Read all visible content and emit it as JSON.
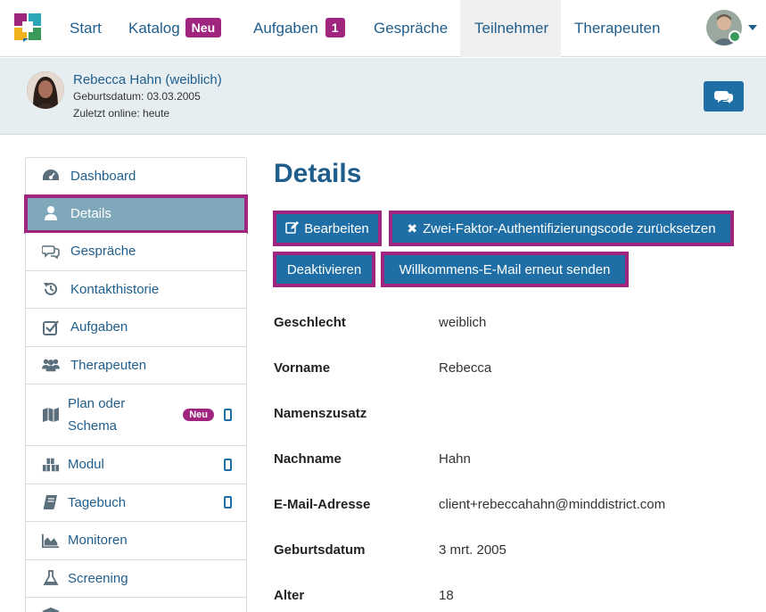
{
  "nav": {
    "start": "Start",
    "katalog": "Katalog",
    "katalog_badge": "Neu",
    "aufgaben": "Aufgaben",
    "aufgaben_badge": "1",
    "gespraeche": "Gespräche",
    "teilnehmer": "Teilnehmer",
    "therapeuten": "Therapeuten"
  },
  "patient": {
    "name": "Rebecca Hahn (weiblich)",
    "birth": "Geburtsdatum: 03.03.2005",
    "online": "Zuletzt online: heute"
  },
  "sidebar": {
    "items": [
      {
        "label": "Dashboard",
        "icon": "dashboard-icon"
      },
      {
        "label": "Details",
        "icon": "user-icon"
      },
      {
        "label": "Gespräche",
        "icon": "comments-icon"
      },
      {
        "label": "Kontakthistorie",
        "icon": "history-icon"
      },
      {
        "label": "Aufgaben",
        "icon": "check-square-icon"
      },
      {
        "label": "Therapeuten",
        "icon": "users-icon"
      },
      {
        "label_line1": "Plan oder",
        "label_line2": "Schema",
        "icon": "map-icon",
        "badge": "Neu"
      },
      {
        "label": "Modul",
        "icon": "cubes-icon"
      },
      {
        "label": "Tagebuch",
        "icon": "book-icon"
      },
      {
        "label": "Monitoren",
        "icon": "area-chart-icon"
      },
      {
        "label": "Screening",
        "icon": "flask-icon"
      }
    ]
  },
  "main": {
    "title": "Details",
    "buttons": {
      "edit": "Bearbeiten",
      "reset_2fa": "Zwei-Faktor-Authentifizierungscode zurücksetzen",
      "deactivate": "Deaktivieren",
      "resend_welcome": "Willkommens-E-Mail erneut senden"
    },
    "fields": [
      {
        "label": "Geschlecht",
        "value": "weiblich"
      },
      {
        "label": "Vorname",
        "value": "Rebecca"
      },
      {
        "label": "Namenszusatz",
        "value": ""
      },
      {
        "label": "Nachname",
        "value": "Hahn"
      },
      {
        "label": "E-Mail-Adresse",
        "value": "client+rebeccahahn@minddistrict.com"
      },
      {
        "label": "Geburtsdatum",
        "value": "3 mrt. 2005"
      },
      {
        "label": "Alter",
        "value": "18"
      }
    ]
  },
  "colors": {
    "brand_blue": "#1f5e8c",
    "button_blue": "#1f6fa6",
    "highlight_purple": "#a0257e"
  }
}
